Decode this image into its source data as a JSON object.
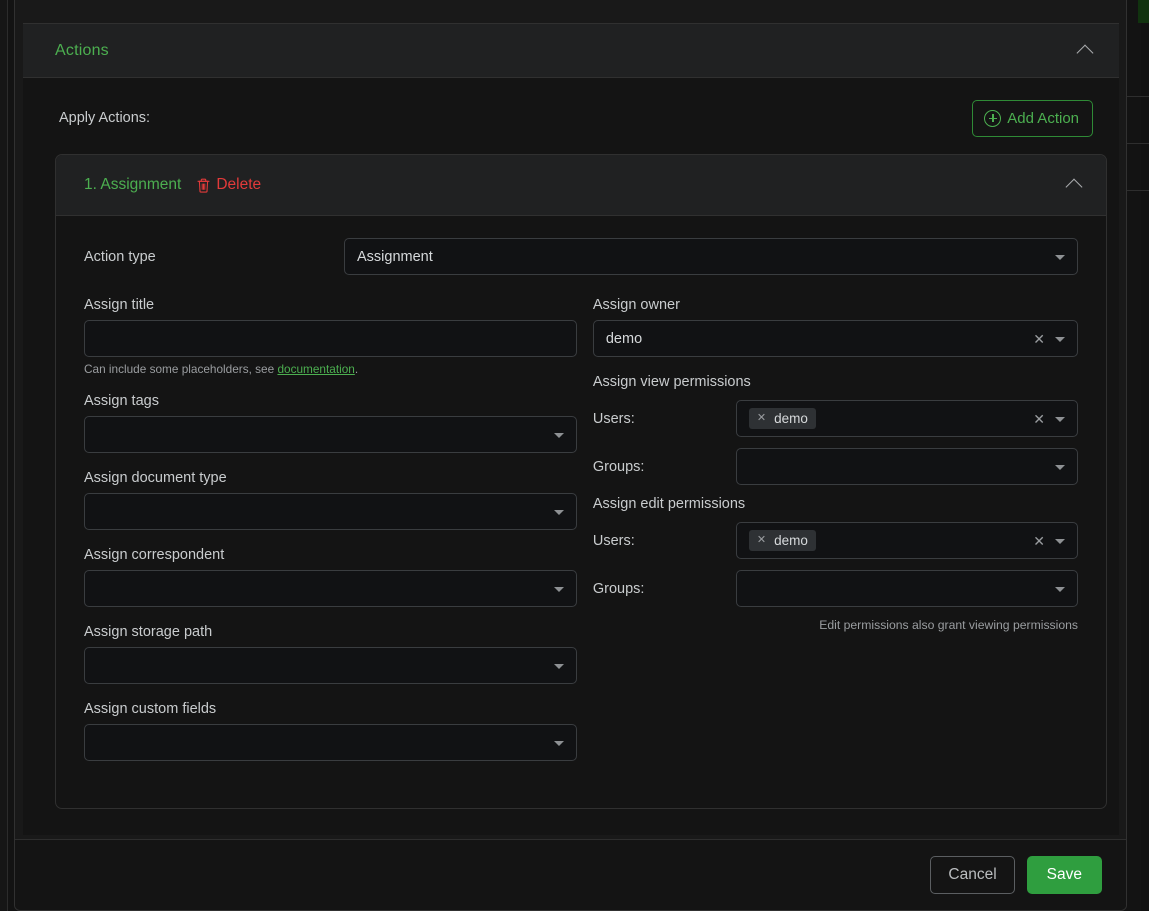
{
  "colors": {
    "accent_green": "#4CAF50",
    "danger_red": "#e23a3a",
    "save_green": "#2f9e3f",
    "panel_bg": "#141414",
    "header_bg": "#202122",
    "border": "#303030",
    "text_primary": "#c9ccce",
    "text_muted": "#9a9da0"
  },
  "accordion": {
    "title": "Actions",
    "collapse_icon": "chevron-up-icon"
  },
  "toolbar": {
    "apply_actions_label": "Apply Actions:",
    "add_action_label": "Add Action",
    "add_action_icon": "plus-circle-icon"
  },
  "action_card": {
    "title": "1. Assignment",
    "delete_label": "Delete",
    "delete_icon": "trash-icon",
    "collapse_icon": "chevron-up-icon",
    "action_type": {
      "label": "Action type",
      "value": "Assignment",
      "caret_icon": "caret-down-icon"
    },
    "left_column": [
      {
        "name": "assign-title",
        "label": "Assign title",
        "type": "text",
        "value": "",
        "placeholder": "",
        "hint_prefix": "Can include some placeholders, see ",
        "hint_link": "documentation",
        "hint_suffix": "."
      },
      {
        "name": "assign-tags",
        "label": "Assign tags",
        "type": "select",
        "value": "",
        "caret_icon": "caret-down-icon"
      },
      {
        "name": "assign-document-type",
        "label": "Assign document type",
        "type": "select",
        "value": "",
        "caret_icon": "caret-down-icon"
      },
      {
        "name": "assign-correspondent",
        "label": "Assign correspondent",
        "type": "select",
        "value": "",
        "caret_icon": "caret-down-icon"
      },
      {
        "name": "assign-storage-path",
        "label": "Assign storage path",
        "type": "select",
        "value": "",
        "caret_icon": "caret-down-icon"
      },
      {
        "name": "assign-custom-fields",
        "label": "Assign custom fields",
        "type": "select",
        "value": "",
        "caret_icon": "caret-down-icon"
      }
    ],
    "right_column": {
      "assign_owner": {
        "label": "Assign owner",
        "value": "demo",
        "clear_icon": "clear-x-icon",
        "caret_icon": "caret-down-icon"
      },
      "view_permissions": {
        "label": "Assign view permissions",
        "users_label": "Users:",
        "users_chips": [
          "demo"
        ],
        "users_clear_icon": "clear-x-icon",
        "groups_label": "Groups:",
        "groups_chips": [],
        "groups_value": ""
      },
      "edit_permissions": {
        "label": "Assign edit permissions",
        "users_label": "Users:",
        "users_chips": [
          "demo"
        ],
        "users_clear_icon": "clear-x-icon",
        "groups_label": "Groups:",
        "groups_chips": [],
        "groups_value": "",
        "note": "Edit permissions also grant viewing permissions"
      }
    }
  },
  "footer": {
    "cancel_label": "Cancel",
    "save_label": "Save"
  }
}
